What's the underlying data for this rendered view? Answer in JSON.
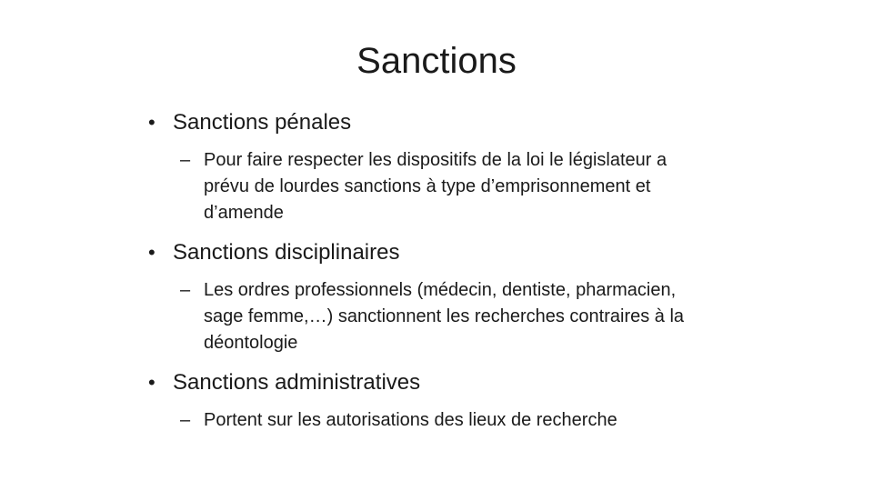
{
  "slide": {
    "title": "Sanctions",
    "items": [
      {
        "bullet": "•",
        "heading": "Sanctions pénales",
        "dash": "–",
        "detail": "Pour faire respecter les dispositifs de la loi le législateur a prévu de lourdes sanctions à type d’emprisonnement et d’amende"
      },
      {
        "bullet": "•",
        "heading": "Sanctions disciplinaires",
        "dash": "–",
        "detail": "Les ordres professionnels (médecin, dentiste, pharmacien, sage femme,…) sanctionnent les recherches contraires à la déontologie"
      },
      {
        "bullet": "•",
        "heading": "Sanctions administratives",
        "dash": "–",
        "detail": "Portent sur les autorisations des lieux de recherche"
      }
    ]
  }
}
